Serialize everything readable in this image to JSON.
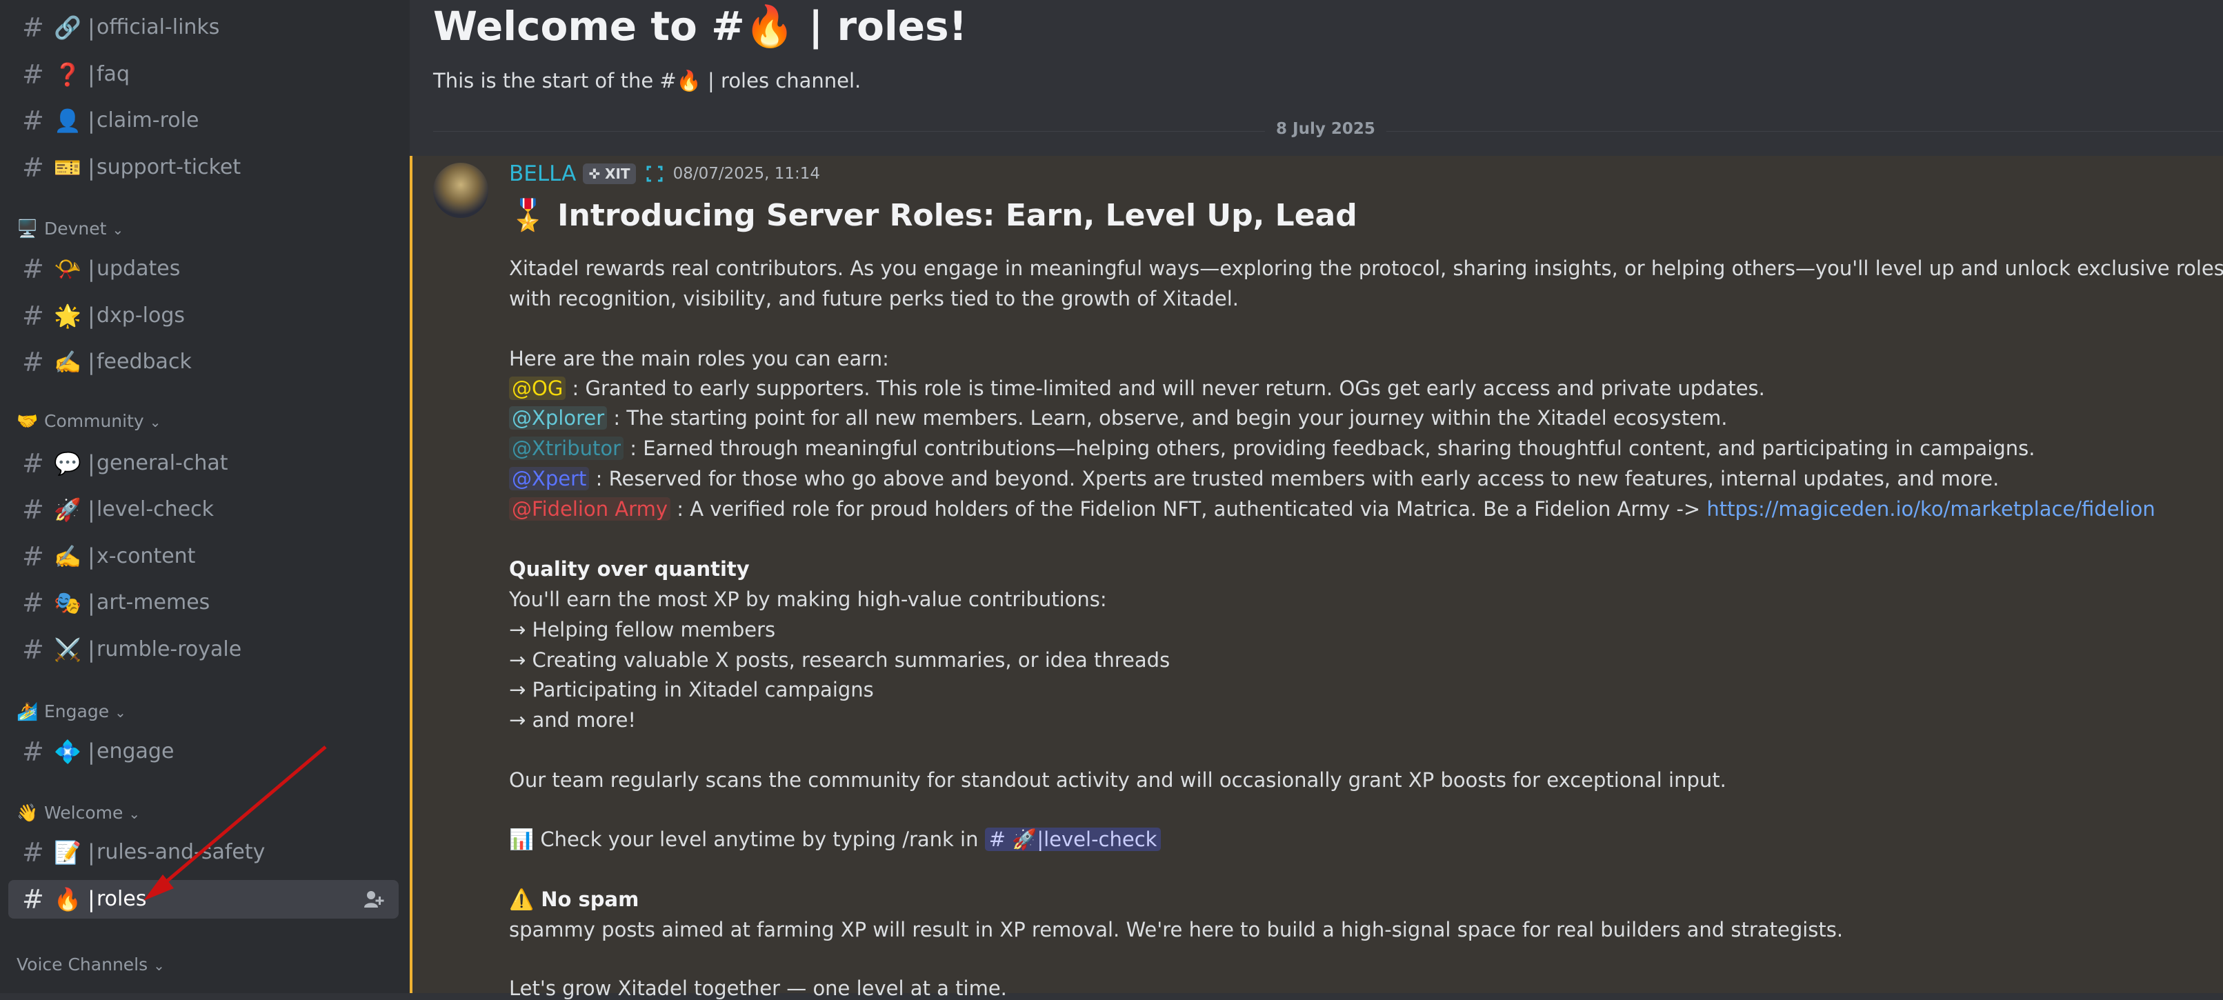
{
  "sidebar": {
    "groups": [
      {
        "category": null,
        "items": [
          {
            "emoji": "🔗",
            "name": "official-links"
          },
          {
            "emoji": "❓",
            "name": "faq"
          },
          {
            "emoji": "👤",
            "name": "claim-role"
          },
          {
            "emoji": "🎫",
            "name": "support-ticket"
          }
        ]
      },
      {
        "category": "Devnet",
        "category_emoji": "🖥️",
        "items": [
          {
            "emoji": "📯",
            "name": "updates"
          },
          {
            "emoji": "🌟",
            "name": "dxp-logs"
          },
          {
            "emoji": "✍️",
            "name": "feedback"
          }
        ]
      },
      {
        "category": "Community",
        "category_emoji": "🤝",
        "items": [
          {
            "emoji": "💬",
            "name": "general-chat"
          },
          {
            "emoji": "🚀",
            "name": "level-check"
          },
          {
            "emoji": "✍️",
            "name": "x-content"
          },
          {
            "emoji": "🎭",
            "name": "art-memes"
          },
          {
            "emoji": "⚔️",
            "name": "rumble-royale"
          }
        ]
      },
      {
        "category": "Engage",
        "category_emoji": "🏄",
        "items": [
          {
            "emoji": "💠",
            "name": " engage"
          }
        ]
      },
      {
        "category": "Welcome",
        "category_emoji": "👋",
        "items": [
          {
            "emoji": "📝",
            "name": "rules-and-safety"
          },
          {
            "emoji": "🔥",
            "name": "roles"
          }
        ]
      },
      {
        "category": "Voice Channels",
        "category_emoji": "",
        "items": []
      }
    ],
    "category_chevron": "⌄",
    "hash": "#"
  },
  "channel": {
    "welcome_title": "Welcome to #🔥 | roles!",
    "welcome_subtitle": "This is the start of the #🔥 | roles channel.",
    "date_divider": "8 July 2025"
  },
  "message": {
    "author": "BELLA",
    "tag": "✜ XIT",
    "timestamp": "08/07/2025, 11:14",
    "heading_emoji": "🎖️",
    "heading": "Introducing Server Roles: Earn, Level Up, Lead",
    "intro_1": "Xitadel rewards real contributors. As you engage in meaningful ways—exploring the protocol, sharing insights, or helping others—you'll level up and unlock exclusive roles that come",
    "intro_2": "with recognition, visibility, and future perks tied to the growth of Xitadel.",
    "roles_intro": "Here are the main roles you can earn:",
    "roles": [
      {
        "mention": "@OG",
        "desc": " : Granted to early supporters. This role is time-limited and will never return. OGs get early access and private updates."
      },
      {
        "mention": "@Xplorer",
        "desc": " : The starting point for all new members. Learn, observe, and begin your journey within the Xitadel ecosystem."
      },
      {
        "mention": "@Xtributor",
        "desc": " : Earned through meaningful contributions—helping others, providing feedback, sharing thoughtful content, and participating in campaigns."
      },
      {
        "mention": "@Xpert",
        "desc": " : Reserved for those who go above and beyond. Xperts are trusted members with early access to new features, internal updates, and more."
      },
      {
        "mention": "@Fidelion Army",
        "desc": " :   A verified role for proud holders of the Fidelion NFT, authenticated via Matrica. Be a Fidelion Army -> ",
        "link": "https://magiceden.io/ko/marketplace/fidelion"
      }
    ],
    "quality_title": "Quality over quantity",
    "quality_intro": "You'll earn the most XP by making high-value contributions:",
    "quality_items": [
      "→ Helping fellow members",
      "→ Creating valuable X posts, research summaries, or idea threads",
      "→ Participating in Xitadel campaigns",
      "→ and more!"
    ],
    "team_scan": "Our team regularly scans the community for standout activity and will occasionally grant XP boosts for exceptional input.",
    "level_emoji": "📊",
    "level_text": " Check your level anytime by typing /rank in ",
    "level_channel": "# 🚀|level-check",
    "spam_emoji": "⚠️",
    "spam_title": "No spam",
    "spam_text": "spammy posts aimed at farming XP will result in XP removal. We're here to build a high-signal space for real builders and strategists.",
    "closing": "Let's grow Xitadel together — one level at a time."
  },
  "colors": {
    "sidebar_bg": "#2b2d31",
    "main_bg": "#313338",
    "highlight_msg_bg": "#3a3733",
    "highlight_accent": "#f0b232",
    "author": "#2fb7d6",
    "link": "#6ea7f7",
    "arrow": "#cc1111"
  }
}
